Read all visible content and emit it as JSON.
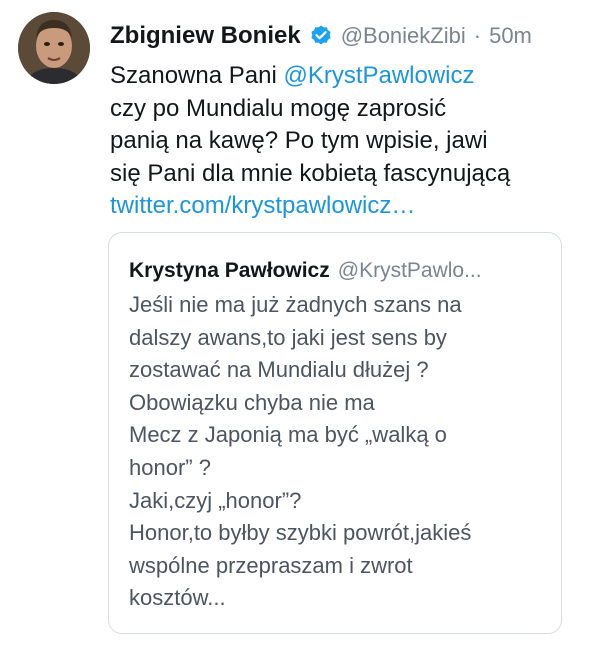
{
  "tweet": {
    "author_name": "Zbigniew Boniek",
    "author_handle": "@BoniekZibi",
    "separator": "·",
    "time": "50m",
    "text_lines": [
      {
        "before": "Szanowna Pani ",
        "mention": "@KrystPawlowicz"
      },
      "czy po Mundialu mogę zaprosić",
      "panią na kawę? Po tym wpisie, jawi",
      "się Pani dla mnie kobietą fascynującą"
    ],
    "link_text": " twitter.com/krystpawlowicz…"
  },
  "quote": {
    "author_name": "Krystyna Pawłowicz",
    "author_handle": "@KrystPawlo...",
    "text_lines": [
      "Jeśli nie ma już żadnych szans na",
      "dalszy awans,to jaki jest sens by",
      "zostawać na Mundialu dłużej ?",
      "Obowiązku chyba nie ma",
      "Mecz z Japonią ma być „walką o",
      "honor” ?",
      "Jaki,czyj „honor”?",
      "Honor,to byłby szybki powrót,jakieś",
      "wspólne przepraszam i zwrot",
      "kosztów..."
    ]
  },
  "colors": {
    "link": "#1b95e0",
    "verified": "#1da1f2",
    "muted": "#7a8590"
  },
  "icons": {
    "verified": "verified-badge-icon"
  }
}
